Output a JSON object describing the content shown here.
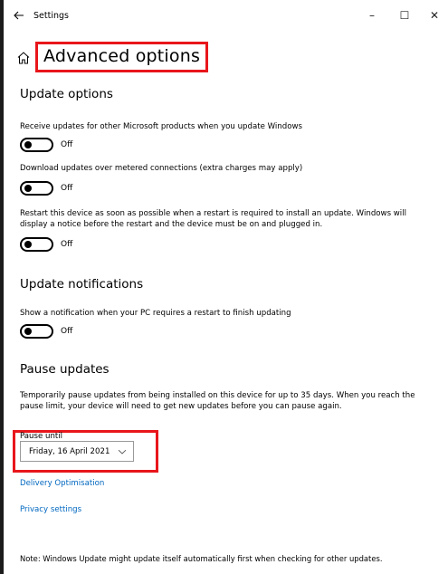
{
  "window": {
    "app_title": "Settings",
    "back_icon": "back-arrow-icon",
    "minimize_label": "–",
    "maximize_label": "☐",
    "close_label": "✕"
  },
  "header": {
    "icon": "home-icon",
    "title": "Advanced options",
    "highlight_color": "#e8161b"
  },
  "update_options": {
    "heading": "Update options",
    "items": [
      {
        "description": "Receive updates for other Microsoft products when you update Windows",
        "state": "Off"
      },
      {
        "description": "Download updates over metered connections (extra charges may apply)",
        "state": "Off"
      },
      {
        "description": "Restart this device as soon as possible when a restart is required to install an update. Windows will display a notice before the restart and the device must be on and plugged in.",
        "state": "Off"
      }
    ]
  },
  "update_notifications": {
    "heading": "Update notifications",
    "items": [
      {
        "description": "Show a notification when your PC requires a restart to finish updating",
        "state": "Off"
      }
    ]
  },
  "pause_updates": {
    "heading": "Pause updates",
    "description": "Temporarily pause updates from being installed on this device for up to 35 days. When you reach the pause limit, your device will need to get new updates before you can pause again.",
    "pause_until_label": "Pause until",
    "selected_date": "Friday, 16 April 2021"
  },
  "links": {
    "delivery_optimisation": "Delivery Optimisation",
    "privacy_settings": "Privacy settings",
    "link_color": "#0067c0"
  },
  "note": "Note: Windows Update might update itself automatically first when checking for other updates."
}
